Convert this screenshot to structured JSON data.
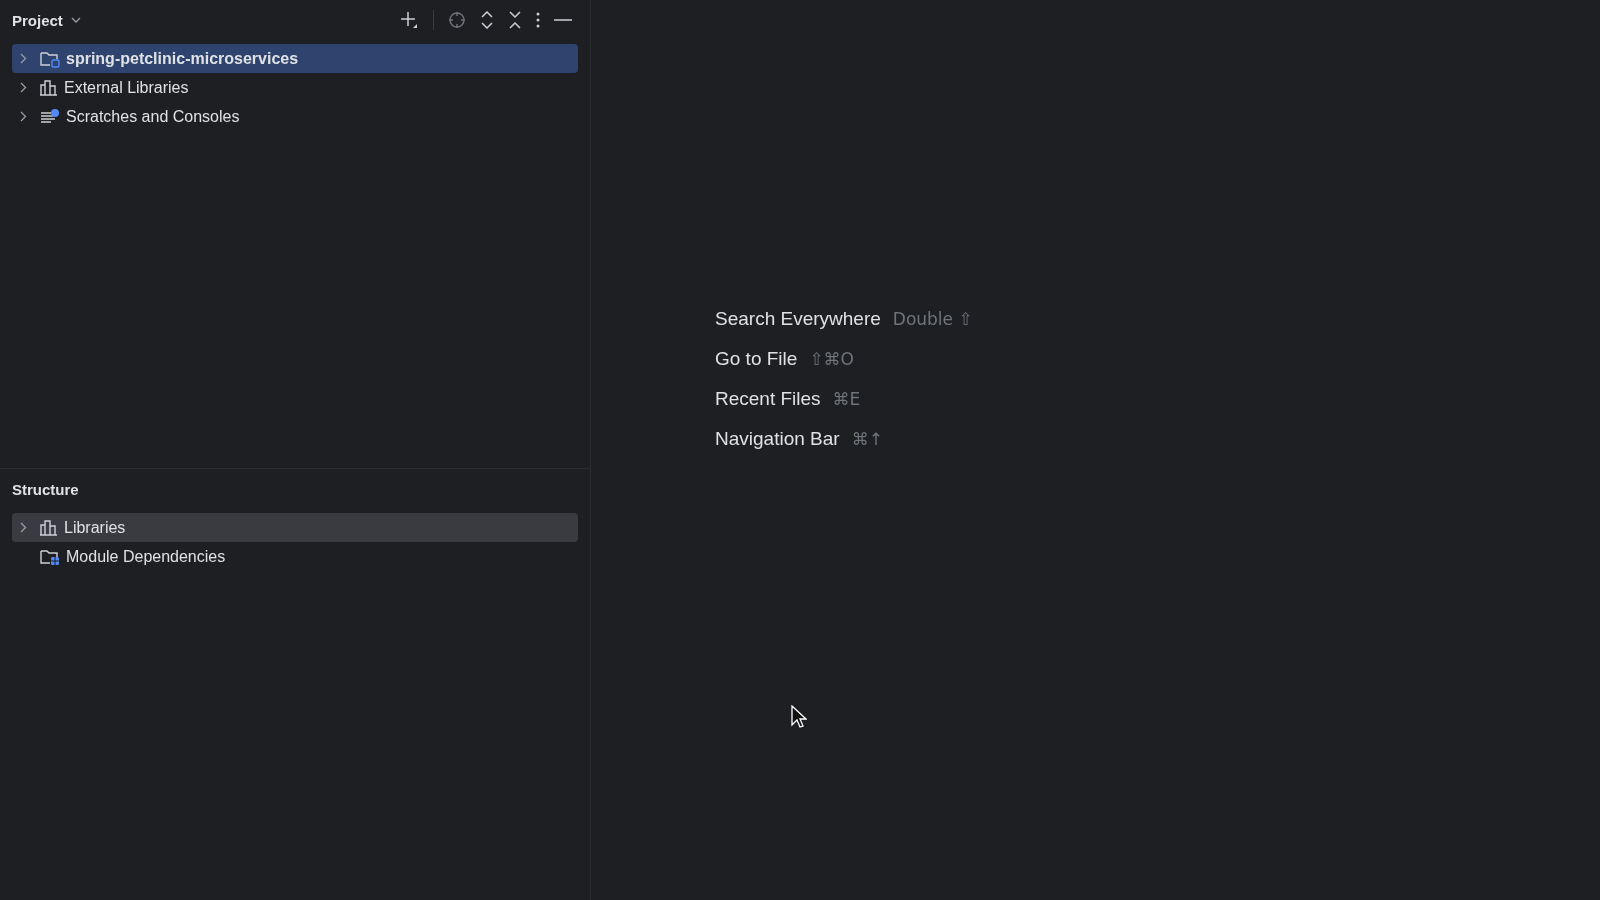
{
  "project_panel": {
    "title": "Project",
    "focused": true,
    "items": [
      {
        "label": "spring-petclinic-microservices",
        "kind": "module",
        "selected": true,
        "expandable": true
      },
      {
        "label": "External Libraries",
        "kind": "library",
        "selected": false,
        "expandable": true
      },
      {
        "label": "Scratches and Consoles",
        "kind": "scratches",
        "selected": false,
        "expandable": true
      }
    ]
  },
  "structure_panel": {
    "title": "Structure",
    "focused": false,
    "items": [
      {
        "label": "Libraries",
        "kind": "library",
        "selected": true,
        "expandable": true
      },
      {
        "label": "Module Dependencies",
        "kind": "dependencies",
        "selected": false,
        "expandable": false
      }
    ]
  },
  "editor_hints": [
    {
      "action": "Search Everywhere",
      "shortcut": "Double ⇧"
    },
    {
      "action": "Go to File",
      "shortcut": "⇧⌘O"
    },
    {
      "action": "Recent Files",
      "shortcut": "⌘E"
    },
    {
      "action": "Navigation Bar",
      "shortcut": "⌘↑"
    }
  ]
}
